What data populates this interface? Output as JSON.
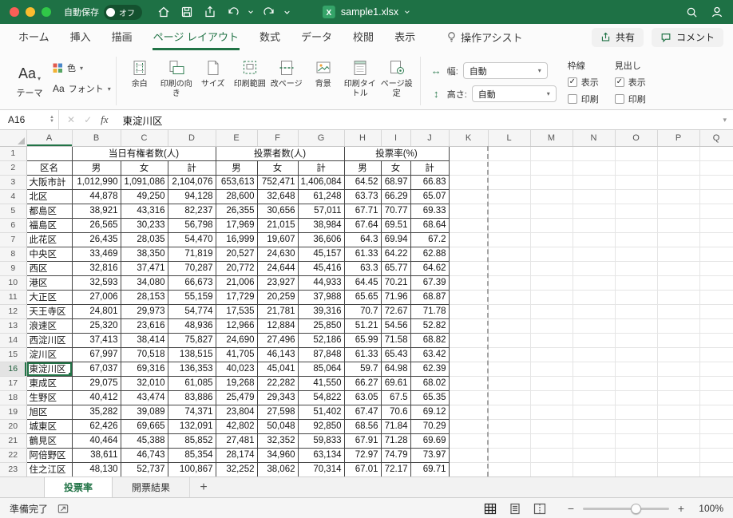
{
  "colors": {
    "accent_green": "#217346",
    "titlebar_green": "#1e7145"
  },
  "titlebar": {
    "autosave_label": "自動保存",
    "autosave_state": "オフ",
    "filename": "sample1.xlsx"
  },
  "ribbon_tabs": {
    "items": [
      {
        "label": "ホーム"
      },
      {
        "label": "挿入"
      },
      {
        "label": "描画"
      },
      {
        "label": "ページ レイアウト"
      },
      {
        "label": "数式"
      },
      {
        "label": "データ"
      },
      {
        "label": "校閲"
      },
      {
        "label": "表示"
      }
    ],
    "assist_label": "操作アシスト",
    "share_label": "共有",
    "comments_label": "コメント"
  },
  "ribbon": {
    "theme_glyph": "Aa",
    "theme_label": "テーマ",
    "colors_label": "色",
    "fonts_glyph": "Aa",
    "fonts_label": "フォント",
    "buttons": [
      "余白",
      "印刷の向き",
      "サイズ",
      "印刷範囲",
      "改ページ",
      "背景",
      "印刷タイトル",
      "ページ設定"
    ],
    "width_label": "幅:",
    "width_value": "自動",
    "height_label": "高さ:",
    "height_value": "自動",
    "gridlines_label": "枠線",
    "headings_label": "見出し",
    "view_label": "表示",
    "print_label": "印刷"
  },
  "formula_bar": {
    "name_box": "A16",
    "fx_label": "fx",
    "content": "東淀川区"
  },
  "grid": {
    "col_letters": [
      "A",
      "B",
      "C",
      "D",
      "E",
      "F",
      "G",
      "H",
      "I",
      "J",
      "K",
      "L",
      "M",
      "N",
      "O",
      "P",
      "Q"
    ],
    "active_cell": "A16",
    "merged_headers": [
      "当日有権者数(人)",
      "投票者数(人)",
      "投票率(%)"
    ],
    "sub_headers": [
      "男",
      "女",
      "計",
      "男",
      "女",
      "計",
      "男",
      "女",
      "計"
    ],
    "row2_name_label": "区名",
    "rows": [
      {
        "num": 1,
        "type": "merged"
      },
      {
        "num": 2,
        "type": "subheaders"
      },
      {
        "num": 3,
        "type": "data",
        "name": "大阪市計",
        "values": [
          "1,012,990",
          "1,091,086",
          "2,104,076",
          "653,613",
          "752,471",
          "1,406,084",
          "64.52",
          "68.97",
          "66.83"
        ]
      },
      {
        "num": 4,
        "type": "data",
        "name": "北区",
        "values": [
          "44,878",
          "49,250",
          "94,128",
          "28,600",
          "32,648",
          "61,248",
          "63.73",
          "66.29",
          "65.07"
        ]
      },
      {
        "num": 5,
        "type": "data",
        "name": "都島区",
        "values": [
          "38,921",
          "43,316",
          "82,237",
          "26,355",
          "30,656",
          "57,011",
          "67.71",
          "70.77",
          "69.33"
        ]
      },
      {
        "num": 6,
        "type": "data",
        "name": "福島区",
        "values": [
          "26,565",
          "30,233",
          "56,798",
          "17,969",
          "21,015",
          "38,984",
          "67.64",
          "69.51",
          "68.64"
        ]
      },
      {
        "num": 7,
        "type": "data",
        "name": "此花区",
        "values": [
          "26,435",
          "28,035",
          "54,470",
          "16,999",
          "19,607",
          "36,606",
          "64.3",
          "69.94",
          "67.2"
        ]
      },
      {
        "num": 8,
        "type": "data",
        "name": "中央区",
        "values": [
          "33,469",
          "38,350",
          "71,819",
          "20,527",
          "24,630",
          "45,157",
          "61.33",
          "64.22",
          "62.88"
        ]
      },
      {
        "num": 9,
        "type": "data",
        "name": "西区",
        "values": [
          "32,816",
          "37,471",
          "70,287",
          "20,772",
          "24,644",
          "45,416",
          "63.3",
          "65.77",
          "64.62"
        ]
      },
      {
        "num": 10,
        "type": "data",
        "name": "港区",
        "values": [
          "32,593",
          "34,080",
          "66,673",
          "21,006",
          "23,927",
          "44,933",
          "64.45",
          "70.21",
          "67.39"
        ]
      },
      {
        "num": 11,
        "type": "data",
        "name": "大正区",
        "values": [
          "27,006",
          "28,153",
          "55,159",
          "17,729",
          "20,259",
          "37,988",
          "65.65",
          "71.96",
          "68.87"
        ]
      },
      {
        "num": 12,
        "type": "data",
        "name": "天王寺区",
        "values": [
          "24,801",
          "29,973",
          "54,774",
          "17,535",
          "21,781",
          "39,316",
          "70.7",
          "72.67",
          "71.78"
        ]
      },
      {
        "num": 13,
        "type": "data",
        "name": "浪速区",
        "values": [
          "25,320",
          "23,616",
          "48,936",
          "12,966",
          "12,884",
          "25,850",
          "51.21",
          "54.56",
          "52.82"
        ]
      },
      {
        "num": 14,
        "type": "data",
        "name": "西淀川区",
        "values": [
          "37,413",
          "38,414",
          "75,827",
          "24,690",
          "27,496",
          "52,186",
          "65.99",
          "71.58",
          "68.82"
        ]
      },
      {
        "num": 15,
        "type": "data",
        "name": "淀川区",
        "values": [
          "67,997",
          "70,518",
          "138,515",
          "41,705",
          "46,143",
          "87,848",
          "61.33",
          "65.43",
          "63.42"
        ]
      },
      {
        "num": 16,
        "type": "data",
        "name": "東淀川区",
        "values": [
          "67,037",
          "69,316",
          "136,353",
          "40,023",
          "45,041",
          "85,064",
          "59.7",
          "64.98",
          "62.39"
        ]
      },
      {
        "num": 17,
        "type": "data",
        "name": "東成区",
        "values": [
          "29,075",
          "32,010",
          "61,085",
          "19,268",
          "22,282",
          "41,550",
          "66.27",
          "69.61",
          "68.02"
        ]
      },
      {
        "num": 18,
        "type": "data",
        "name": "生野区",
        "values": [
          "40,412",
          "43,474",
          "83,886",
          "25,479",
          "29,343",
          "54,822",
          "63.05",
          "67.5",
          "65.35"
        ]
      },
      {
        "num": 19,
        "type": "data",
        "name": "旭区",
        "values": [
          "35,282",
          "39,089",
          "74,371",
          "23,804",
          "27,598",
          "51,402",
          "67.47",
          "70.6",
          "69.12"
        ]
      },
      {
        "num": 20,
        "type": "data",
        "name": "城東区",
        "values": [
          "62,426",
          "69,665",
          "132,091",
          "42,802",
          "50,048",
          "92,850",
          "68.56",
          "71.84",
          "70.29"
        ]
      },
      {
        "num": 21,
        "type": "data",
        "name": "鶴見区",
        "values": [
          "40,464",
          "45,388",
          "85,852",
          "27,481",
          "32,352",
          "59,833",
          "67.91",
          "71.28",
          "69.69"
        ]
      },
      {
        "num": 22,
        "type": "data",
        "name": "阿倍野区",
        "values": [
          "38,611",
          "46,743",
          "85,354",
          "28,174",
          "34,960",
          "63,134",
          "72.97",
          "74.79",
          "73.97"
        ]
      },
      {
        "num": 23,
        "type": "data",
        "name": "住之江区",
        "values": [
          "48,130",
          "52,737",
          "100,867",
          "32,252",
          "38,062",
          "70,314",
          "67.01",
          "72.17",
          "69.71"
        ]
      }
    ]
  },
  "sheet_tabs": {
    "tabs": [
      {
        "label": "投票率",
        "active": true
      },
      {
        "label": "開票結果",
        "active": false
      }
    ]
  },
  "status_bar": {
    "ready_label": "準備完了",
    "zoom_value": "100%"
  }
}
